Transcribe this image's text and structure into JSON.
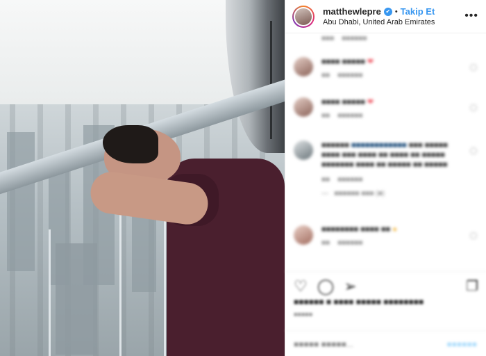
{
  "header": {
    "username": "matthewlepre",
    "verified_glyph": "✔",
    "separator": "•",
    "follow_label": "Takip Et",
    "location": "Abu Dhabi, United Arab Emirates",
    "more_glyph": "•••"
  },
  "icons": {
    "verified": "verified-badge-icon",
    "more": "more-options-icon",
    "like": "heart-icon",
    "comment": "comment-icon",
    "share": "share-icon",
    "save": "bookmark-icon"
  },
  "colors": {
    "accent": "#3897f0",
    "text": "#262626",
    "muted": "#8e8e8e",
    "heart_emoji": "#ed4956"
  }
}
